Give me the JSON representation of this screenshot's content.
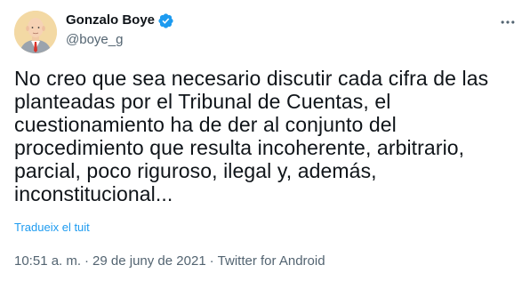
{
  "author": {
    "name": "Gonzalo Boye",
    "handle": "@boye_g",
    "verified_icon": "verified-badge-icon"
  },
  "tweet": {
    "text": "No creo que sea necesario discutir cada cifra de las planteadas por el Tribunal de Cuentas, el cuestionamiento ha de der al conjunto del procedimiento que resulta incoherente, arbitrario, parcial, poco riguroso, ilegal y, además, inconstitucional...",
    "translate_label": "Tradueix el tuit"
  },
  "meta": {
    "time": "10:51 a. m.",
    "separator": "·",
    "date": "29 de juny de 2021",
    "source": "Twitter for Android"
  },
  "icons": {
    "more": "more-options-icon",
    "avatar": "avatar"
  },
  "colors": {
    "accent": "#1d9bf0",
    "text": "#0f1419",
    "muted": "#536471"
  }
}
